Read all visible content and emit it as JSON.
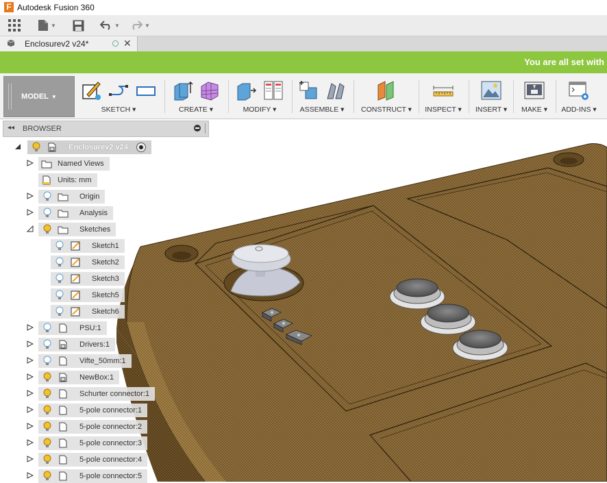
{
  "app": {
    "title": "Autodesk Fusion 360",
    "logo_letter": "F"
  },
  "document_tab": {
    "title": "Enclosurev2 v24*"
  },
  "banner": {
    "message": "You are all set with"
  },
  "toolbar": {
    "workspace": "MODEL",
    "groups": [
      {
        "label": "SKETCH"
      },
      {
        "label": "CREATE"
      },
      {
        "label": "MODIFY"
      },
      {
        "label": "ASSEMBLE"
      },
      {
        "label": "CONSTRUCT"
      },
      {
        "label": "INSPECT"
      },
      {
        "label": "INSERT"
      },
      {
        "label": "MAKE"
      },
      {
        "label": "ADD-INS"
      }
    ]
  },
  "browser": {
    "title": "BROWSER",
    "root": {
      "label": "Enclosurev2 v24"
    },
    "items": [
      {
        "label": "Named Views"
      },
      {
        "label": "Units: mm"
      },
      {
        "label": "Origin"
      },
      {
        "label": "Analysis"
      },
      {
        "label": "Sketches"
      },
      {
        "label": "Sketch1"
      },
      {
        "label": "Sketch2"
      },
      {
        "label": "Sketch3"
      },
      {
        "label": "Sketch5"
      },
      {
        "label": "Sketch6"
      },
      {
        "label": "PSU:1"
      },
      {
        "label": "Drivers:1"
      },
      {
        "label": "Vifte_50mm:1"
      },
      {
        "label": "NewBox:1"
      },
      {
        "label": "Schurter connector:1"
      },
      {
        "label": "5-pole connector:1"
      },
      {
        "label": "5-pole connector:2"
      },
      {
        "label": "5-pole connector:3"
      },
      {
        "label": "5-pole connector:4"
      },
      {
        "label": "5-pole connector:5"
      }
    ]
  },
  "colors": {
    "banner": "#8dc63f",
    "wood": "#8b6b3a",
    "bulb_on": "#f2c230",
    "bulb_off": "#5aa0d6"
  }
}
